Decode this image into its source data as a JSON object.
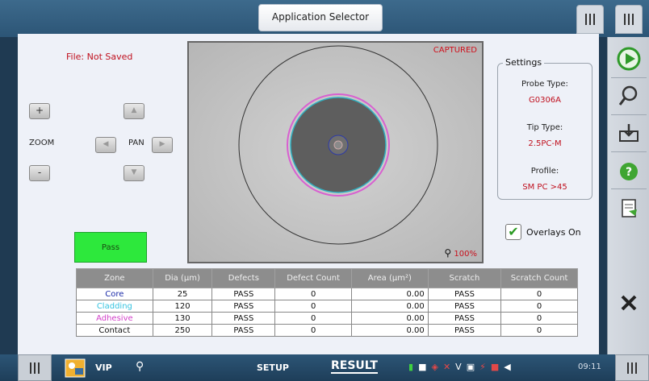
{
  "header": {
    "app_selector_label": "Application Selector"
  },
  "left_panel": {
    "file_status": "File: Not Saved",
    "zoom_in": "+",
    "zoom_out": "-",
    "zoom_label": "ZOOM",
    "pan_label": "PAN",
    "result_badge": "Pass"
  },
  "viewer": {
    "status": "CAPTURED",
    "zoom_level": "100%"
  },
  "settings": {
    "title": "Settings",
    "probe_type_label": "Probe Type:",
    "probe_type_value": "G0306A",
    "tip_type_label": "Tip Type:",
    "tip_type_value": "2.5PC-M",
    "profile_label": "Profile:",
    "profile_value": "SM PC >45"
  },
  "overlays": {
    "label": "Overlays On",
    "checked": true
  },
  "table": {
    "headers": [
      "Zone",
      "Dia (µm)",
      "Defects",
      "Defect Count",
      "Area (µm²)",
      "Scratch",
      "Scratch Count"
    ],
    "rows": [
      {
        "zone": "Core",
        "dia": "25",
        "defects": "PASS",
        "defect_count": "0",
        "area": "0.00",
        "scratch": "PASS",
        "scratch_count": "0",
        "color": "#1a2aa8"
      },
      {
        "zone": "Cladding",
        "dia": "120",
        "defects": "PASS",
        "defect_count": "0",
        "area": "0.00",
        "scratch": "PASS",
        "scratch_count": "0",
        "color": "#36c3e0"
      },
      {
        "zone": "Adhesive",
        "dia": "130",
        "defects": "PASS",
        "defect_count": "0",
        "area": "0.00",
        "scratch": "PASS",
        "scratch_count": "0",
        "color": "#d23fc8"
      },
      {
        "zone": "Contact",
        "dia": "250",
        "defects": "PASS",
        "defect_count": "0",
        "area": "0.00",
        "scratch": "PASS",
        "scratch_count": "0",
        "color": "#111111"
      }
    ]
  },
  "bottom_bar": {
    "vip_label": "VIP",
    "setup_label": "SETUP",
    "result_label": "RESULT",
    "time": "09:11"
  },
  "colors": {
    "pass_green": "#2de83c",
    "alert_red": "#c0101e",
    "toolbar_blue": "#2c5576"
  }
}
